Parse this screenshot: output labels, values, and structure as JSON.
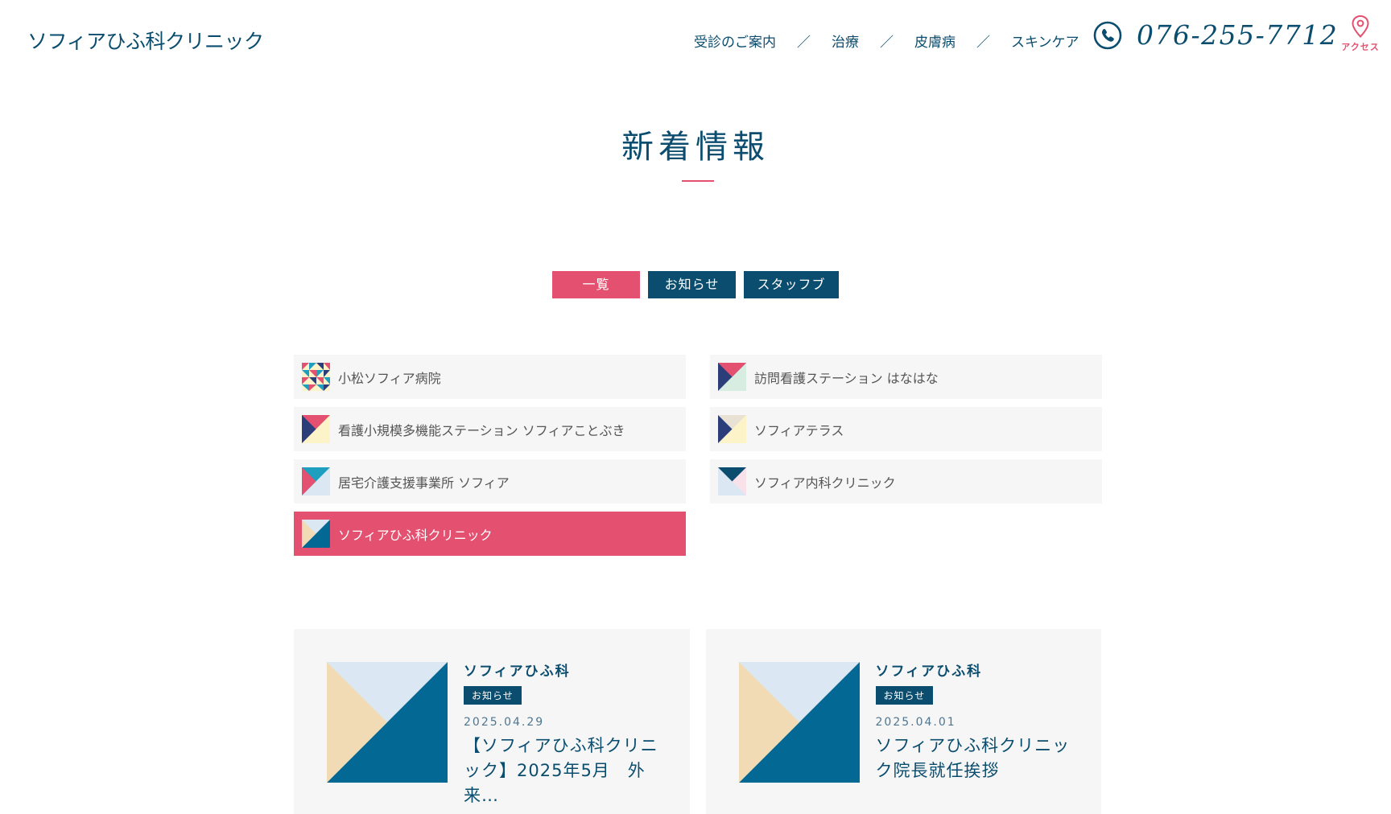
{
  "header": {
    "logo_text": "ソフィアひふ科クリニック",
    "nav": [
      {
        "label": "受診のご案内"
      },
      {
        "label": "治療"
      },
      {
        "label": "皮膚病"
      },
      {
        "label": "スキンケア"
      }
    ],
    "nav_separator": "／",
    "phone": "076-255-7712",
    "access_label": "アクセス"
  },
  "page": {
    "title": "新着情報"
  },
  "filter_tabs": [
    {
      "label": "一覧",
      "active": true
    },
    {
      "label": "お知らせ",
      "active": false
    },
    {
      "label": "スタッフブログ",
      "active": false
    }
  ],
  "facilities": [
    {
      "label": "小松ソフィア病院",
      "icon": "mosaic-icon"
    },
    {
      "label": "訪問看護ステーション はなはな",
      "icon": "triangle-icon"
    },
    {
      "label": "看護小規模多機能ステーション ソフィアことぶき",
      "icon": "triangle-icon"
    },
    {
      "label": "ソフィアテラス",
      "icon": "triangle-icon"
    },
    {
      "label": "居宅介護支援事業所 ソフィア",
      "icon": "triangle-icon"
    },
    {
      "label": "ソフィア内科クリニック",
      "icon": "triangle-icon"
    },
    {
      "label": "ソフィアひふ科クリニック",
      "icon": "triangle-icon",
      "active": true
    }
  ],
  "news": [
    {
      "clinic": "ソフィアひふ科",
      "category": "お知らせ",
      "date": "2025.04.29",
      "title": "【ソフィアひふ科クリニック】2025年5月　外来…"
    },
    {
      "clinic": "ソフィアひふ科",
      "category": "お知らせ",
      "date": "2025.04.01",
      "title": "ソフィアひふ科クリニック院長就任挨拶"
    }
  ],
  "colors": {
    "brand_navy": "#0b4d6e",
    "accent_pink": "#e4506f",
    "card_bg": "#f6f6f6"
  }
}
